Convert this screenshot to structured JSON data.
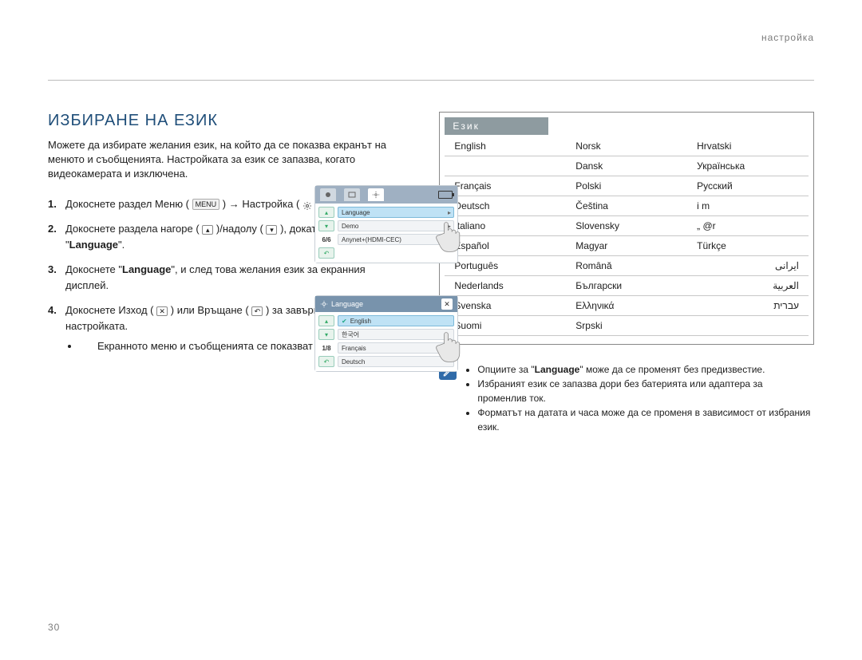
{
  "chapter": "настройка",
  "heading": "ИЗБИРАНЕ НА ЕЗИК",
  "intro": "Можете да избирате желания език, на който да се показва екранът на менюто и съобщенията. Настройката за език се запазва, когато видеокамерата и изключена.",
  "steps": {
    "n1": "1.",
    "s1a": "Докоснете раздел Меню (",
    "s1b": ") → Настройка (",
    "s1c": ").",
    "menu_label": "MENU",
    "n2": "2.",
    "s2a": "Докоснете раздела нагоре (",
    "s2b": ")/надолу (",
    "s2c": "), докато се покаже \"",
    "s2bold": "Language",
    "s2d": "\".",
    "n3": "3.",
    "s3a": "Докоснете \"",
    "s3bold": "Language",
    "s3b": "\", и след това желания език за екранния дисплей.",
    "n4": "4.",
    "s4a": "Докоснете Изход (",
    "s4x": "✕",
    "s4b": ") или Връщане (",
    "s4ret": "↶",
    "s4c": ") за завършване на настройката.",
    "s4bullet": "Екранното меню и съобщенията се показват на избрания език."
  },
  "shot1": {
    "row1": "Language",
    "row2": "Demo",
    "row3": "Anynet+(HDMI-CEC)",
    "pager": "6/6"
  },
  "shot2": {
    "title": "Language",
    "row1": "English",
    "row2": "한국어",
    "row3": "Français",
    "row4": "Deutsch",
    "pager": "1/8"
  },
  "lang_header": "Език",
  "langs": {
    "c1": [
      "English",
      "",
      "Français",
      "Deutsch",
      "Italiano",
      "Español",
      "Português",
      "Nederlands",
      "Svenska",
      "Suomi"
    ],
    "c2": [
      "Norsk",
      "Dansk",
      "Polski",
      "Čeština",
      "Slovensky",
      "Magyar",
      "Română",
      "Български",
      "Ελληνικά",
      "Srpski"
    ],
    "c3": [
      "Hrvatski",
      "Українська",
      "Русский",
      "i m",
      "„ @r",
      "Türkçe",
      "ايرانى",
      "العربية",
      "עברית",
      ""
    ]
  },
  "notes": {
    "b1": "Опциите за \"Language\" може да се променят без предизвестие.",
    "b1_bold": "Language",
    "b2": "Избраният език се запазва дори без батерията или адаптера за променлив ток.",
    "b3": "Форматът на датата и часа може да се променя в зависимост от избрания език."
  },
  "page_number": "30"
}
